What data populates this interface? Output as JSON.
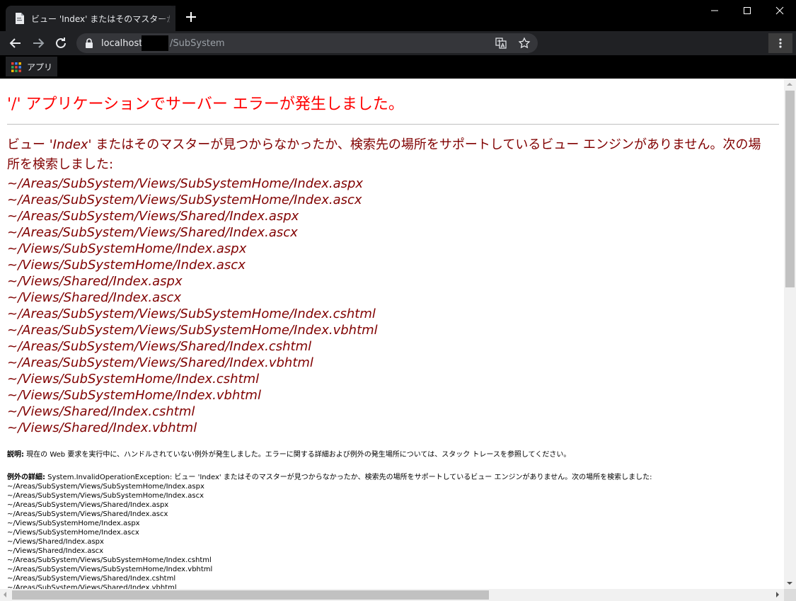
{
  "browser": {
    "tab_title": "ビュー 'Index' またはそのマスターが見つ",
    "url_host": "localhost",
    "url_path": "/SubSystem",
    "bookmarks_apps_label": "アプリ"
  },
  "page": {
    "heading": "'/' アプリケーションでサーバー エラーが発生しました。",
    "message_prefix": "ビュー ",
    "message_view_name": "'Index'",
    "message_rest": " またはそのマスターが見つからなかったか、検索先の場所をサポートしているビュー エンジンがありません。次の場所を検索しました:",
    "searched_paths": [
      "~/Areas/SubSystem/Views/SubSystemHome/Index.aspx",
      "~/Areas/SubSystem/Views/SubSystemHome/Index.ascx",
      "~/Areas/SubSystem/Views/Shared/Index.aspx",
      "~/Areas/SubSystem/Views/Shared/Index.ascx",
      "~/Views/SubSystemHome/Index.aspx",
      "~/Views/SubSystemHome/Index.ascx",
      "~/Views/Shared/Index.aspx",
      "~/Views/Shared/Index.ascx",
      "~/Areas/SubSystem/Views/SubSystemHome/Index.cshtml",
      "~/Areas/SubSystem/Views/SubSystemHome/Index.vbhtml",
      "~/Areas/SubSystem/Views/Shared/Index.cshtml",
      "~/Areas/SubSystem/Views/Shared/Index.vbhtml",
      "~/Views/SubSystemHome/Index.cshtml",
      "~/Views/SubSystemHome/Index.vbhtml",
      "~/Views/Shared/Index.cshtml",
      "~/Views/Shared/Index.vbhtml"
    ],
    "description_label": "説明:",
    "description_text": " 現在の Web 要求を実行中に、ハンドルされていない例外が発生しました。エラーに関する詳細および例外の発生場所については、スタック トレースを参照してください。",
    "exception_label": "例外の詳細:",
    "exception_text": " System.InvalidOperationException: ビュー 'Index' またはそのマスターが見つからなかったか、検索先の場所をサポートしているビュー エンジンがありません。次の場所を検索しました:",
    "exception_paths": [
      "~/Areas/SubSystem/Views/SubSystemHome/Index.aspx",
      "~/Areas/SubSystem/Views/SubSystemHome/Index.ascx",
      "~/Areas/SubSystem/Views/Shared/Index.aspx",
      "~/Areas/SubSystem/Views/Shared/Index.ascx",
      "~/Views/SubSystemHome/Index.aspx",
      "~/Views/SubSystemHome/Index.ascx",
      "~/Views/Shared/Index.aspx",
      "~/Views/Shared/Index.ascx",
      "~/Areas/SubSystem/Views/SubSystemHome/Index.cshtml",
      "~/Areas/SubSystem/Views/SubSystemHome/Index.vbhtml",
      "~/Areas/SubSystem/Views/Shared/Index.cshtml",
      "~/Areas/SubSystem/Views/Shared/Index.vbhtml"
    ]
  },
  "colors": {
    "heading": "#ff0000",
    "message": "#800000",
    "chrome_dark": "#202124"
  }
}
